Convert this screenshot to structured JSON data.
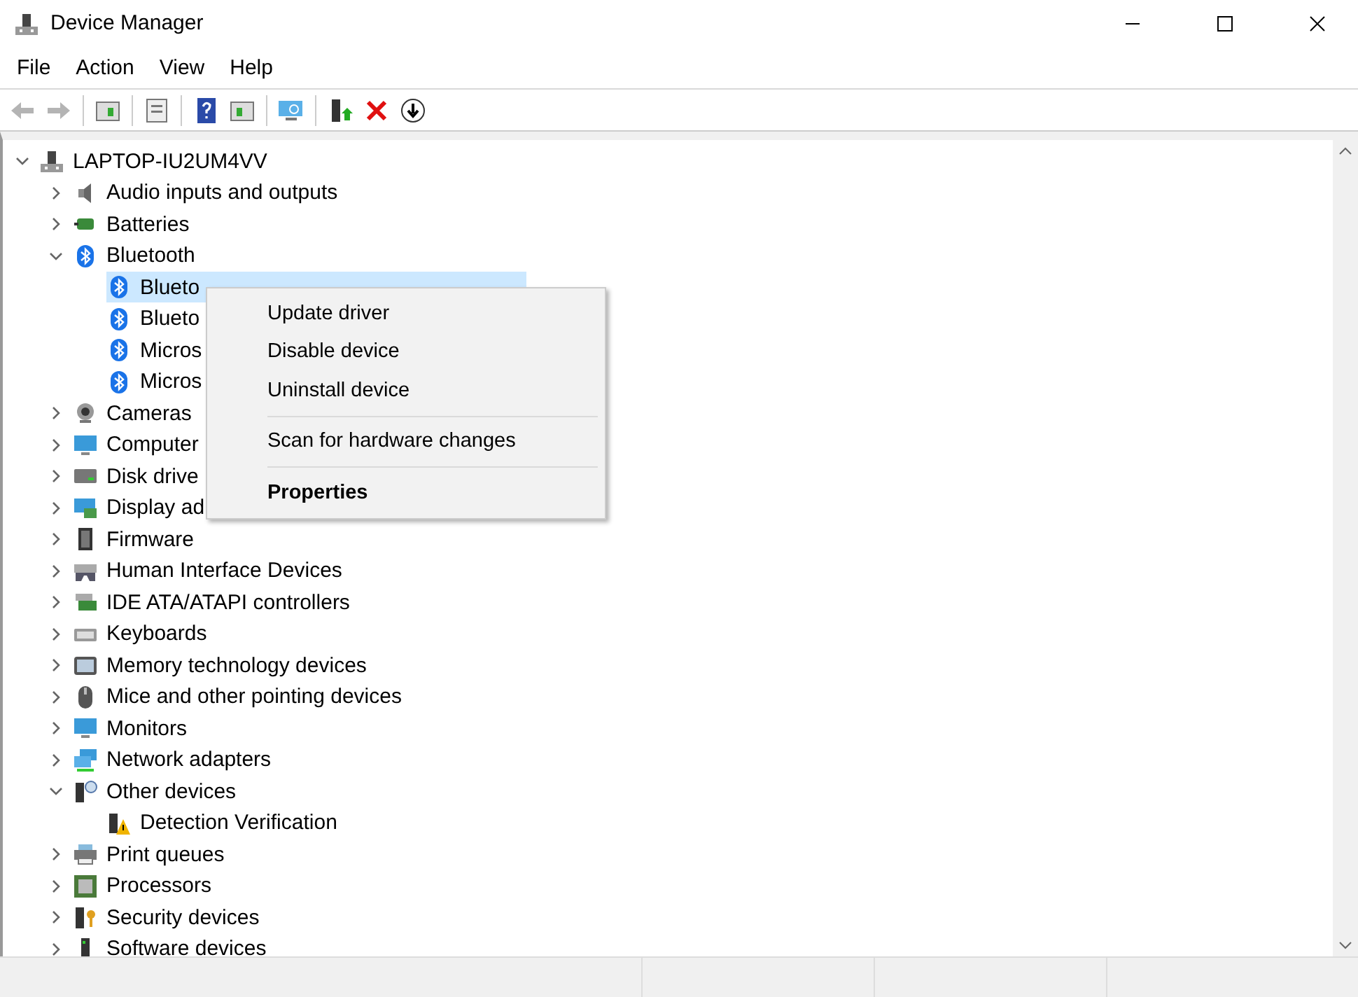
{
  "window": {
    "title": "Device Manager"
  },
  "menu_bar": [
    "File",
    "Action",
    "View",
    "Help"
  ],
  "toolbar": [
    {
      "kind": "back",
      "disabled": true
    },
    {
      "kind": "forward",
      "disabled": true
    },
    {
      "kind": "sep"
    },
    {
      "kind": "tree",
      "disabled": false
    },
    {
      "kind": "sep"
    },
    {
      "kind": "properties",
      "disabled": false
    },
    {
      "kind": "sep"
    },
    {
      "kind": "help",
      "disabled": false
    },
    {
      "kind": "pane",
      "disabled": false
    },
    {
      "kind": "sep"
    },
    {
      "kind": "scan",
      "disabled": false
    },
    {
      "kind": "sep"
    },
    {
      "kind": "update",
      "disabled": false
    },
    {
      "kind": "uninstall",
      "disabled": false
    },
    {
      "kind": "download",
      "disabled": false
    }
  ],
  "tree": {
    "label": "LAPTOP-IU2UM4VV",
    "expanded": true,
    "selected": false,
    "children": [
      {
        "label": "Audio inputs and outputs",
        "expanded": false,
        "selected": false
      },
      {
        "label": "Batteries",
        "expanded": false,
        "selected": false
      },
      {
        "label": "Bluetooth",
        "expanded": true,
        "selected": false,
        "children": [
          {
            "label": "Blueto",
            "selected": true
          },
          {
            "label": "Blueto",
            "selected": false
          },
          {
            "label": "Micros",
            "selected": false
          },
          {
            "label": "Micros",
            "selected": false
          }
        ]
      },
      {
        "label": "Cameras",
        "expanded": false,
        "selected": false
      },
      {
        "label": "Computer",
        "expanded": false,
        "selected": false
      },
      {
        "label": "Disk drive",
        "expanded": false,
        "selected": false
      },
      {
        "label": "Display ad",
        "expanded": false,
        "selected": false
      },
      {
        "label": "Firmware",
        "expanded": false,
        "selected": false
      },
      {
        "label": "Human Interface Devices",
        "expanded": false,
        "selected": false
      },
      {
        "label": "IDE ATA/ATAPI controllers",
        "expanded": false,
        "selected": false
      },
      {
        "label": "Keyboards",
        "expanded": false,
        "selected": false
      },
      {
        "label": "Memory technology devices",
        "expanded": false,
        "selected": false
      },
      {
        "label": "Mice and other pointing devices",
        "expanded": false,
        "selected": false
      },
      {
        "label": "Monitors",
        "expanded": false,
        "selected": false
      },
      {
        "label": "Network adapters",
        "expanded": false,
        "selected": false
      },
      {
        "label": "Other devices",
        "expanded": true,
        "selected": false,
        "children": [
          {
            "label": "Detection Verification",
            "selected": false
          }
        ]
      },
      {
        "label": "Print queues",
        "expanded": false,
        "selected": false
      },
      {
        "label": "Processors",
        "expanded": false,
        "selected": false
      },
      {
        "label": "Security devices",
        "expanded": false,
        "selected": false
      },
      {
        "label": "Software devices",
        "expanded": false,
        "selected": false
      }
    ]
  },
  "context_menu": [
    {
      "kind": "item",
      "label": "Update driver",
      "default": false
    },
    {
      "kind": "item",
      "label": "Disable device",
      "default": false
    },
    {
      "kind": "item",
      "label": "Uninstall device",
      "default": false
    },
    {
      "kind": "separator"
    },
    {
      "kind": "item",
      "label": "Scan for hardware changes",
      "default": false
    },
    {
      "kind": "separator"
    },
    {
      "kind": "item",
      "label": "Properties",
      "default": true
    }
  ]
}
